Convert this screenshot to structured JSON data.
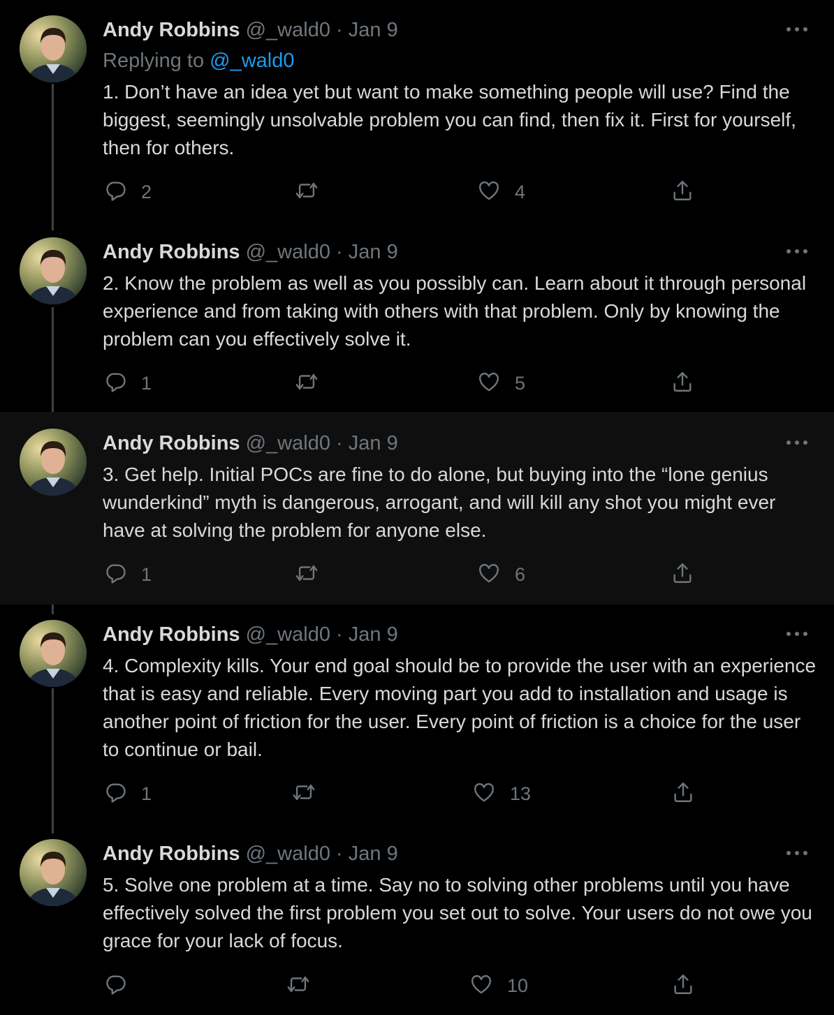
{
  "replying": {
    "prefix": "Replying to",
    "mention": "@_wald0"
  },
  "tweets": [
    {
      "name": "Andy Robbins",
      "handle": "@_wald0",
      "separator": "·",
      "date": "Jan 9",
      "text": "1. Don’t have an idea yet but want to make something people will use? Find the biggest, seemingly unsolvable problem you can find, then fix it. First for yourself, then for others.",
      "replies": "2",
      "retweets": "",
      "likes": "4"
    },
    {
      "name": "Andy Robbins",
      "handle": "@_wald0",
      "separator": "·",
      "date": "Jan 9",
      "text": "2. Know the problem as well as you possibly can. Learn about it through personal experience and from taking with others with that problem. Only by knowing the problem can you effectively solve it.",
      "replies": "1",
      "retweets": "",
      "likes": "5"
    },
    {
      "name": "Andy Robbins",
      "handle": "@_wald0",
      "separator": "·",
      "date": "Jan 9",
      "text": "3. Get help. Initial POCs are fine to do alone, but buying into the “lone genius wunderkind” myth is dangerous, arrogant, and will kill any shot you might ever have at solving the problem for anyone else.",
      "replies": "1",
      "retweets": "",
      "likes": "6"
    },
    {
      "name": "Andy Robbins",
      "handle": "@_wald0",
      "separator": "·",
      "date": "Jan 9",
      "text": "4. Complexity kills. Your end goal should be to provide the user with an experience that is easy and reliable. Every moving part you add to installation and usage is another point of friction for the user. Every point of friction is a choice for the user to continue or bail.",
      "replies": "1",
      "retweets": "",
      "likes": "13"
    },
    {
      "name": "Andy Robbins",
      "handle": "@_wald0",
      "separator": "·",
      "date": "Jan 9",
      "text": "5. Solve one problem at a time. Say no to solving other problems until you have effectively solved the first problem you set out to solve. Your users do not owe you grace for your lack of focus.",
      "replies": "",
      "retweets": "",
      "likes": "10"
    }
  ],
  "icons": {
    "more": "more-horizontal-icon",
    "reply": "reply-bubble-icon",
    "retweet": "retweet-icon",
    "like": "heart-icon",
    "share": "share-upload-icon"
  },
  "colors": {
    "background": "#000000",
    "highlight_background": "#0f0f0f",
    "text": "#d9d9d9",
    "muted": "#6e767d",
    "link": "#1d9bf0"
  }
}
